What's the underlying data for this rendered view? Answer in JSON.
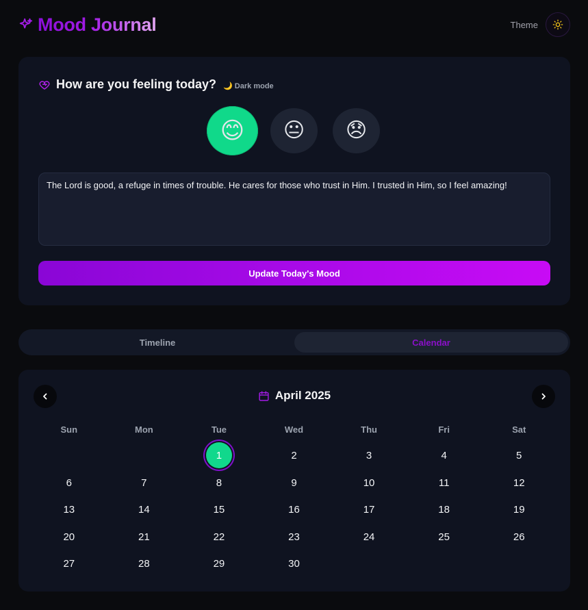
{
  "header": {
    "title": "Mood Journal",
    "theme_label": "Theme",
    "brand_icon": "sparkles-icon",
    "theme_icon": "sun-icon"
  },
  "mood_card": {
    "question": "How are you feeling today?",
    "dark_mode_badge": "🌙 Dark mode",
    "moods": [
      {
        "emoji": "😊",
        "label": "happy",
        "selected": true
      },
      {
        "emoji": "😐",
        "label": "neutral",
        "selected": false
      },
      {
        "emoji": "😞",
        "label": "sad",
        "selected": false
      }
    ],
    "note_text": "The Lord is good, a refuge in times of trouble. He cares for those who trust in Him. I trusted in Him, so I feel amazing!",
    "update_button": "Update Today's Mood"
  },
  "tabs": [
    {
      "label": "Timeline",
      "active": false
    },
    {
      "label": "Calendar",
      "active": true
    }
  ],
  "calendar": {
    "month_label": "April 2025",
    "weekdays": [
      "Sun",
      "Mon",
      "Tue",
      "Wed",
      "Thu",
      "Fri",
      "Sat"
    ],
    "weeks": [
      [
        "",
        "",
        "1",
        "2",
        "3",
        "4",
        "5"
      ],
      [
        "6",
        "7",
        "8",
        "9",
        "10",
        "11",
        "12"
      ],
      [
        "13",
        "14",
        "15",
        "16",
        "17",
        "18",
        "19"
      ],
      [
        "20",
        "21",
        "22",
        "23",
        "24",
        "25",
        "26"
      ],
      [
        "27",
        "28",
        "29",
        "30",
        "",
        "",
        ""
      ]
    ],
    "highlighted_day": "1"
  },
  "colors": {
    "accent": "#a80ae8",
    "happy": "#10d98a",
    "background": "#0a0b0e",
    "card": "#0f1320"
  }
}
